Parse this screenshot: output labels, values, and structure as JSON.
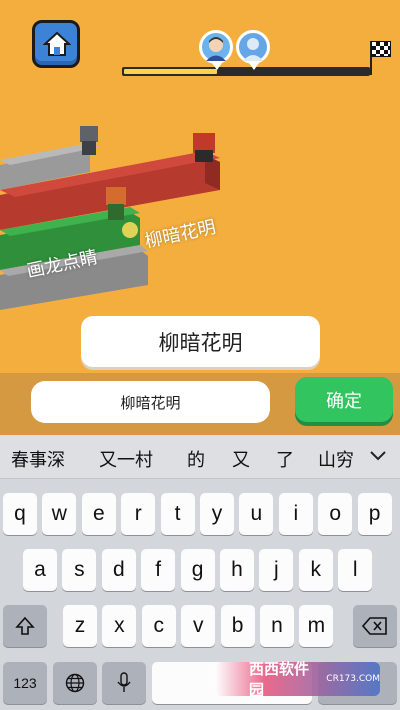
{
  "game": {
    "progress_fraction": 0.38,
    "chips": {
      "player_chip": "画龙点睛",
      "opponent_chip": "柳暗花明"
    },
    "answer_display": "柳暗花明",
    "icons": {
      "home": "home-icon",
      "player_avatar": "user-avatar-icon",
      "opponent_avatar": "opponent-avatar-icon",
      "finish": "checkered-flag-icon"
    },
    "colors": {
      "background": "#f4ae3e",
      "home_button": "#3c83d8",
      "progress_fill": "#ffd24a",
      "confirm_button": "#32c45e"
    }
  },
  "input_bar": {
    "value": "柳暗花明",
    "confirm_label": "确定"
  },
  "keyboard": {
    "candidates": [
      "春事深",
      "又一村",
      "的",
      "又",
      "了",
      "山穷"
    ],
    "row1": [
      "q",
      "w",
      "e",
      "r",
      "t",
      "y",
      "u",
      "i",
      "o",
      "p"
    ],
    "row2": [
      "a",
      "s",
      "d",
      "f",
      "g",
      "h",
      "j",
      "k",
      "l"
    ],
    "row3": [
      "z",
      "x",
      "c",
      "v",
      "b",
      "n",
      "m"
    ],
    "numbers_label": "123",
    "icons": {
      "shift": "shift-icon",
      "delete": "backspace-icon",
      "globe": "globe-icon",
      "mic": "microphone-icon",
      "expand": "chevron-down-icon"
    }
  },
  "watermark": {
    "brand": "西西软件园",
    "site": "CR173.COM"
  }
}
